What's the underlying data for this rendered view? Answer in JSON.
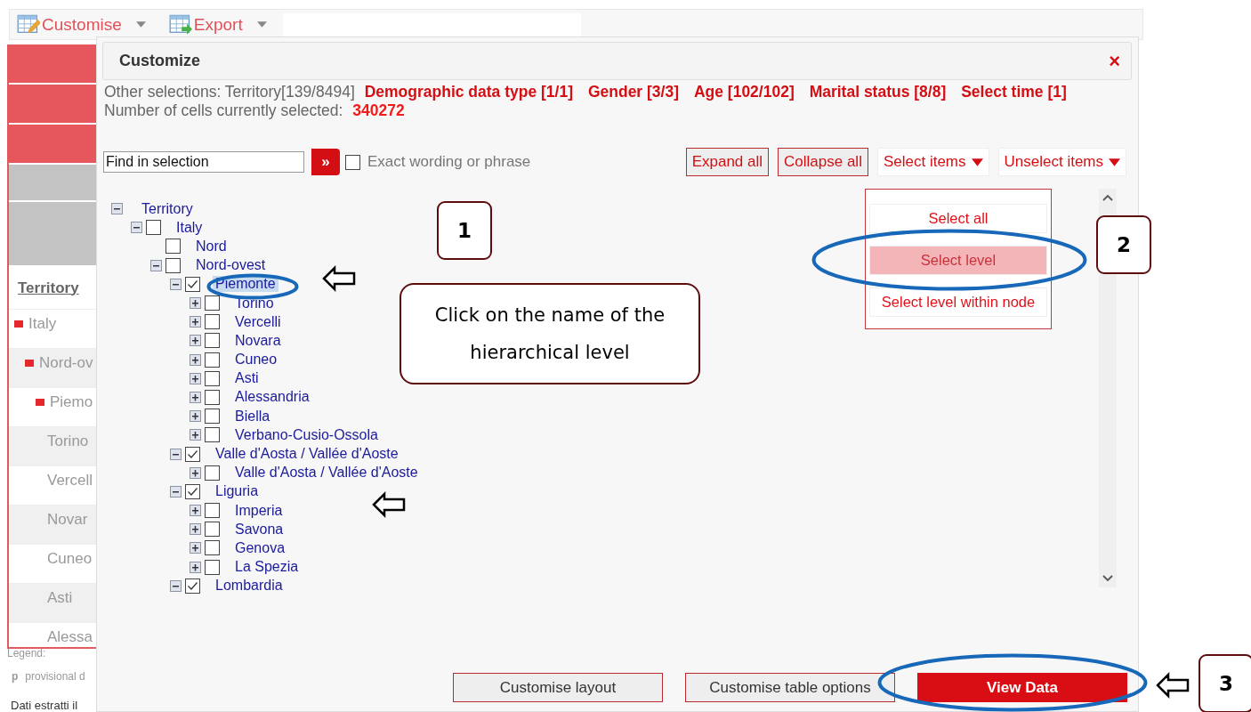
{
  "toolbar": {
    "items": [
      {
        "label": "Customise",
        "kind": "customise"
      },
      {
        "label": "Export",
        "kind": "export"
      }
    ]
  },
  "background_table": {
    "header": "Territory",
    "rows": [
      {
        "label": "Italy",
        "expanded": true
      },
      {
        "label": "Nord-ov",
        "expanded": true
      },
      {
        "label": "Piemo",
        "expanded": true
      },
      {
        "label": "Torino",
        "expanded": false
      },
      {
        "label": "Vercell",
        "expanded": false
      },
      {
        "label": "Novar",
        "expanded": false
      },
      {
        "label": "Cuneo",
        "expanded": false
      },
      {
        "label": "Asti",
        "expanded": false
      },
      {
        "label": "Alessa",
        "expanded": false
      }
    ],
    "legend": "Legend:",
    "legend_mark": "p",
    "legend_text": "provisional d",
    "footer": "Dati estratti il"
  },
  "dialog": {
    "title": "Customize",
    "close": "×",
    "summary": [
      {
        "text": "Other selections: Territory[139/8494]",
        "kind": "plain"
      },
      {
        "text": "Demographic data type [1/1]",
        "kind": "highlight"
      },
      {
        "text": "Gender [3/3]",
        "kind": "highlight"
      },
      {
        "text": "Age [102/102]",
        "kind": "highlight"
      },
      {
        "text": "Marital status [8/8]",
        "kind": "highlight"
      },
      {
        "text": "Select time [1]",
        "kind": "highlight"
      },
      {
        "text": "Number of cells currently selected:",
        "kind": "plain"
      },
      {
        "text": "340272",
        "kind": "value"
      }
    ],
    "search": {
      "value": "Find in selection",
      "go": "»",
      "exact_label": "Exact wording or phrase",
      "exact_checked": false
    },
    "actions": [
      {
        "label": "Expand all",
        "kind": "plain"
      },
      {
        "label": "Collapse all",
        "kind": "plain"
      },
      {
        "label": "Select items",
        "kind": "menu"
      },
      {
        "label": "Unselect items",
        "kind": "menu"
      }
    ],
    "select_menu": [
      {
        "label": "Select all",
        "selected": false
      },
      {
        "label": "Select level",
        "selected": true
      },
      {
        "label": "Select level within node",
        "selected": false
      }
    ],
    "tree": [
      {
        "label": "Territory",
        "kind": "root",
        "expanded": true,
        "selected": false,
        "children": [
          {
            "label": "Italy",
            "kind": "branch",
            "expanded": true,
            "checked": false,
            "selected": false,
            "children": [
              {
                "label": "Nord",
                "kind": "leaf",
                "checked": false,
                "selected": false
              },
              {
                "label": "Nord-ovest",
                "kind": "branch",
                "expanded": true,
                "checked": false,
                "selected": false,
                "children": [
                  {
                    "label": "Piemonte",
                    "kind": "branch",
                    "expanded": true,
                    "checked": true,
                    "selected": true,
                    "children": [
                      {
                        "label": "Torino",
                        "kind": "branch",
                        "expanded": false,
                        "checked": false,
                        "selected": false
                      },
                      {
                        "label": "Vercelli",
                        "kind": "branch",
                        "expanded": false,
                        "checked": false,
                        "selected": false
                      },
                      {
                        "label": "Novara",
                        "kind": "branch",
                        "expanded": false,
                        "checked": false,
                        "selected": false
                      },
                      {
                        "label": "Cuneo",
                        "kind": "branch",
                        "expanded": false,
                        "checked": false,
                        "selected": false
                      },
                      {
                        "label": "Asti",
                        "kind": "branch",
                        "expanded": false,
                        "checked": false,
                        "selected": false
                      },
                      {
                        "label": "Alessandria",
                        "kind": "branch",
                        "expanded": false,
                        "checked": false,
                        "selected": false
                      },
                      {
                        "label": "Biella",
                        "kind": "branch",
                        "expanded": false,
                        "checked": false,
                        "selected": false
                      },
                      {
                        "label": "Verbano-Cusio-Ossola",
                        "kind": "branch",
                        "expanded": false,
                        "checked": false,
                        "selected": false
                      }
                    ]
                  },
                  {
                    "label": "Valle d'Aosta / Vallée d'Aoste",
                    "kind": "branch",
                    "expanded": true,
                    "checked": true,
                    "selected": false,
                    "children": [
                      {
                        "label": "Valle d'Aosta / Vallée d'Aoste",
                        "kind": "branch",
                        "expanded": false,
                        "checked": false,
                        "selected": false
                      }
                    ]
                  },
                  {
                    "label": "Liguria",
                    "kind": "branch",
                    "expanded": true,
                    "checked": true,
                    "selected": false,
                    "children": [
                      {
                        "label": "Imperia",
                        "kind": "branch",
                        "expanded": false,
                        "checked": false,
                        "selected": false
                      },
                      {
                        "label": "Savona",
                        "kind": "branch",
                        "expanded": false,
                        "checked": false,
                        "selected": false
                      },
                      {
                        "label": "Genova",
                        "kind": "branch",
                        "expanded": false,
                        "checked": false,
                        "selected": false
                      },
                      {
                        "label": "La Spezia",
                        "kind": "branch",
                        "expanded": false,
                        "checked": false,
                        "selected": false
                      }
                    ]
                  },
                  {
                    "label": "Lombardia",
                    "kind": "branch",
                    "expanded": true,
                    "checked": true,
                    "selected": false
                  }
                ]
              }
            ]
          }
        ]
      }
    ],
    "buttons": [
      {
        "label": "Customise layout",
        "kind": "secondary"
      },
      {
        "label": "Customise table options",
        "kind": "secondary"
      },
      {
        "label": "View Data",
        "kind": "primary"
      }
    ]
  },
  "annotations": {
    "steps": [
      "1",
      "2",
      "3"
    ],
    "callout": "Click on the name of the hierarchical level"
  }
}
